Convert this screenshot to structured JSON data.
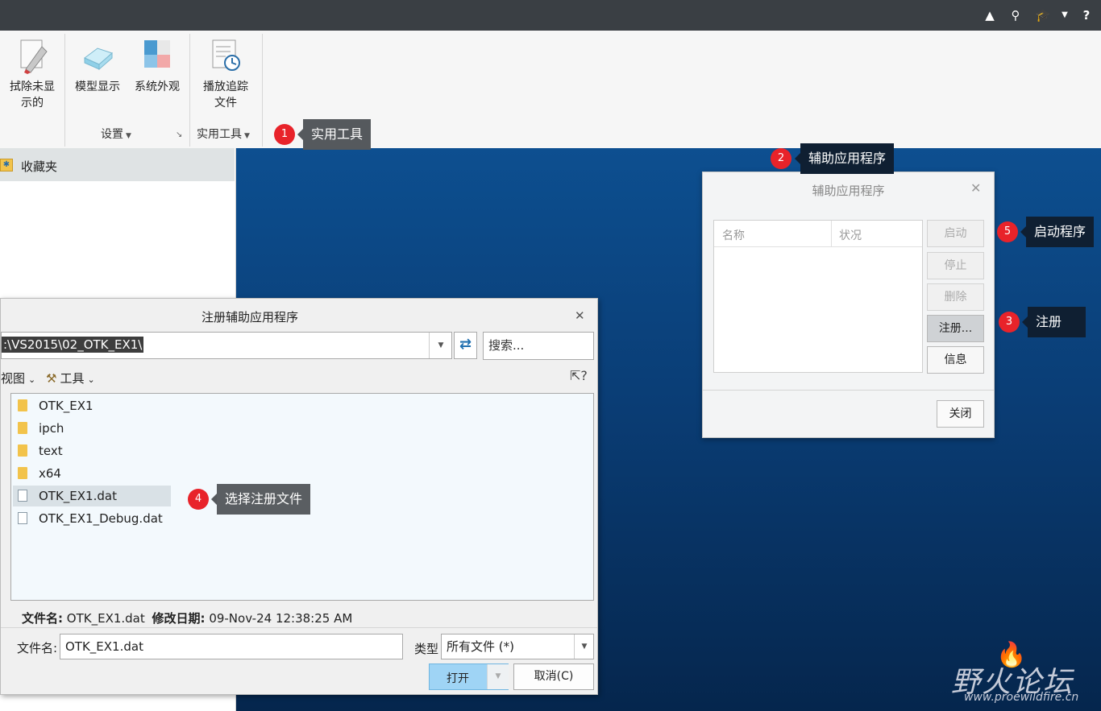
{
  "ribbon": {
    "buttons": [
      {
        "label_line1": "拭除未显",
        "label_line2": "示的",
        "icon": "erase-icon"
      },
      {
        "label_line1": "模型显示",
        "icon": "model-display-icon"
      },
      {
        "label_line1": "系统外观",
        "icon": "system-appearance-icon"
      },
      {
        "label_line1": "播放追踪",
        "label_line2": "文件",
        "icon": "play-trail-icon"
      }
    ],
    "groups": {
      "settings": "设置",
      "utilities": "实用工具"
    }
  },
  "left_panel": {
    "favorites": "收藏夹"
  },
  "callouts": [
    {
      "num": "1",
      "text": "实用工具"
    },
    {
      "num": "2",
      "text": "辅助应用程序"
    },
    {
      "num": "3",
      "text": "注册"
    },
    {
      "num": "4",
      "text": "选择注册文件"
    },
    {
      "num": "5",
      "text": "启动程序"
    }
  ],
  "aux_dialog": {
    "title": "辅助应用程序",
    "columns": [
      "名称",
      "状况"
    ],
    "buttons": {
      "start": "启动",
      "stop": "停止",
      "delete": "删除",
      "register": "注册...",
      "info": "信息",
      "close": "关闭"
    }
  },
  "reg_dialog": {
    "title": "注册辅助应用程序",
    "path": ":\\VS2015\\02_OTK_EX1\\",
    "search_placeholder": "搜索...",
    "view_label": "视图",
    "tools_label": "工具",
    "files": [
      {
        "name": "OTK_EX1",
        "type": "folder"
      },
      {
        "name": "ipch",
        "type": "folder"
      },
      {
        "name": "text",
        "type": "folder"
      },
      {
        "name": "x64",
        "type": "folder"
      },
      {
        "name": "OTK_EX1.dat",
        "type": "dat",
        "selected": true
      },
      {
        "name": "OTK_EX1_Debug.dat",
        "type": "dat"
      }
    ],
    "info_label_name": "文件名:",
    "info_value_name": "OTK_EX1.dat",
    "info_label_date": "修改日期:",
    "info_value_date": "09-Nov-24 12:38:25 AM",
    "filename_label": "文件名:",
    "filename_value": "OTK_EX1.dat",
    "type_label": "类型",
    "type_value": "所有文件 (*)",
    "open": "打开",
    "cancel": "取消(C)"
  },
  "watermark": {
    "brand": "野火论坛",
    "url": "www.proewildfire.cn"
  }
}
